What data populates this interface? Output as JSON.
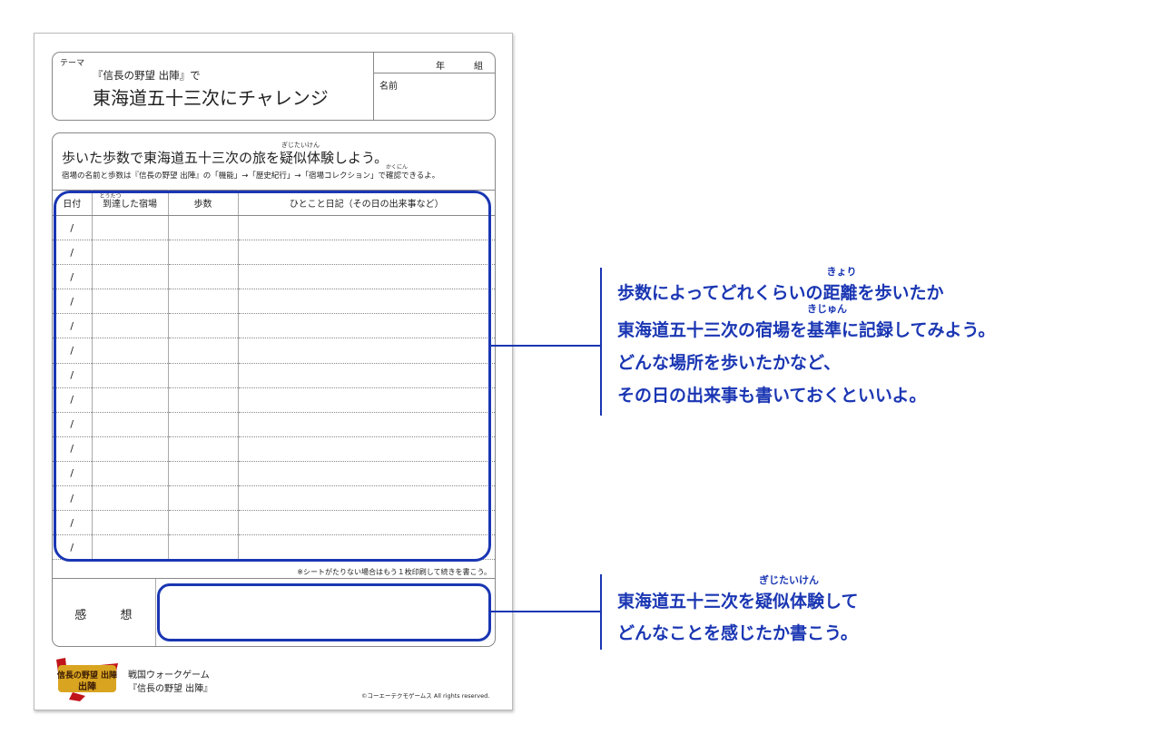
{
  "sheet": {
    "theme_label": "テーマ",
    "theme_sub": "『信長の野望 出陣』で",
    "theme_title": "東海道五十三次にチャレンジ",
    "nen": "年",
    "kumi": "組",
    "namae": "名前",
    "main_title_prefix": "歩いた歩数で東海道五十三次の旅を",
    "main_title_ruby_word": "疑似体験",
    "main_title_ruby": "ぎじたいけん",
    "main_title_suffix": "しよう。",
    "desc_prefix": "宿場の名前と歩数は『信長の野望 出陣』の「機能」→「歴史紀行」→「宿場コレクション」で",
    "desc_ruby_word": "確認",
    "desc_ruby": "かくにん",
    "desc_suffix": "できるよ。",
    "table_headers": [
      "日付",
      "到達した宿場",
      "歩数",
      "ひとこと日記（その日の出来事など）"
    ],
    "header_ruby": "とうたつ",
    "row_date_placeholder": "/",
    "row_count": 14,
    "note": "※シートがたりない場合はもう１枚印刷して続きを書こう。",
    "impressions_label_1": "感",
    "impressions_label_2": "想",
    "footer_logo_text": "信長の野望 出陣",
    "footer_line1": "戦国ウォークゲーム",
    "footer_line2": "『信長の野望 出陣』",
    "copyright": "©コーエーテクモゲームス All rights reserved."
  },
  "callouts": {
    "log": {
      "line1_a": "歩数によってどれくらいの",
      "line1_ruby_word": "距離",
      "line1_ruby": "きょり",
      "line1_b": "を歩いたか",
      "line2_a": "東海道五十三次の宿場を",
      "line2_ruby_word": "基準",
      "line2_ruby": "きじゅん",
      "line2_b": "に記録してみよう。",
      "line3": "どんな場所を歩いたかなど、",
      "line4": "その日の出来事も書いておくといいよ。"
    },
    "impressions": {
      "line1_a": "東海道五十三次を",
      "line1_ruby_word": "疑似体験",
      "line1_ruby": "ぎじたいけん",
      "line1_b": "して",
      "line2": "どんなことを感じたか書こう。"
    }
  },
  "colors": {
    "accent": "#1a36b3",
    "border": "#888888"
  }
}
